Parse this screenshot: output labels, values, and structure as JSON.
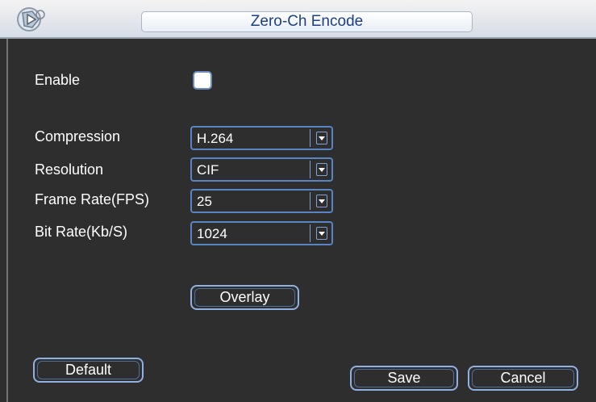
{
  "window": {
    "title": "Zero-Ch Encode",
    "logo_icon": "app-logo-icon"
  },
  "form": {
    "enable": {
      "label": "Enable",
      "checked": false
    },
    "compression": {
      "label": "Compression",
      "value": "H.264"
    },
    "resolution": {
      "label": "Resolution",
      "value": "CIF"
    },
    "frame_rate": {
      "label": "Frame Rate(FPS)",
      "value": "25"
    },
    "bit_rate": {
      "label": "Bit Rate(Kb/S)",
      "value": "1024"
    }
  },
  "buttons": {
    "overlay": "Overlay",
    "default": "Default",
    "save": "Save",
    "cancel": "Cancel"
  },
  "colors": {
    "background": "#2e2e2e",
    "title_text": "#1d3f88",
    "accent_border": "#5a85c4"
  }
}
